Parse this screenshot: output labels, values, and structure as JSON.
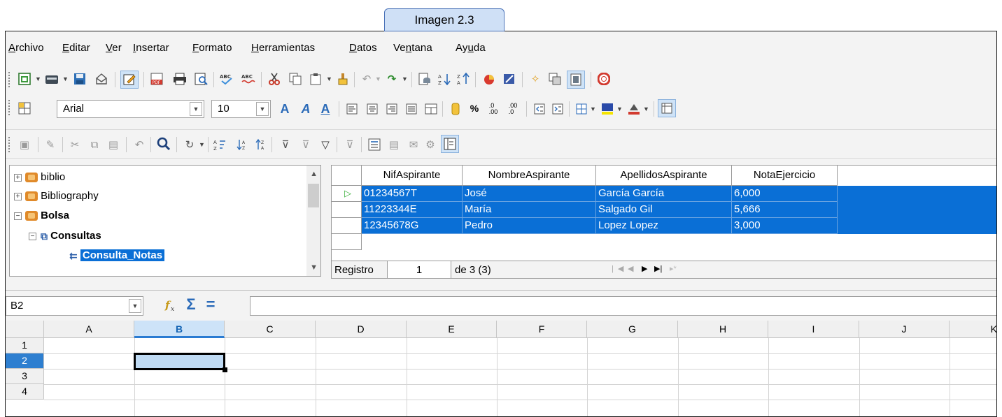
{
  "caption": "Imagen 2.3",
  "menu": [
    "Archivo",
    "Editar",
    "Ver",
    "Insertar",
    "Formato",
    "Herramientas",
    "Datos",
    "Ventana",
    "Ayuda"
  ],
  "menu_underline": [
    "A",
    "E",
    "V",
    "I",
    "F",
    "H",
    "D",
    "n",
    "u"
  ],
  "formatting": {
    "font_name": "Arial",
    "font_size": "10"
  },
  "tree": {
    "items": [
      {
        "label": "biblio",
        "expander": "+"
      },
      {
        "label": "Bibliography",
        "expander": "+"
      },
      {
        "label": "Bolsa",
        "expander": "−"
      },
      {
        "label": "Consultas",
        "expander": "−"
      },
      {
        "label": "Consulta_Notas",
        "expander": ""
      }
    ]
  },
  "table": {
    "columns": [
      "NifAspirante",
      "NombreAspirante",
      "ApellidosAspirante",
      "NotaEjercicio"
    ],
    "rows": [
      [
        "01234567T",
        "José",
        "García García",
        "6,000"
      ],
      [
        "11223344E",
        "María",
        "Salgado Gil",
        "5,666"
      ],
      [
        "12345678G",
        "Pedro",
        "Lopez Lopez",
        "3,000"
      ]
    ],
    "record_label": "Registro",
    "record_value": "1",
    "record_of": "de 3 (3)"
  },
  "formula_bar": {
    "cell_ref": "B2"
  },
  "sheet": {
    "columns": [
      "A",
      "B",
      "C",
      "D",
      "E",
      "F",
      "G",
      "H",
      "I",
      "J",
      "K"
    ],
    "rows": [
      "1",
      "2",
      "3",
      "4"
    ],
    "active_column": "B",
    "active_row": "2"
  },
  "colors": {
    "selection": "#0a6fd6",
    "active_header": "#cde3f8",
    "caption_bg": "#cfe0f6"
  }
}
